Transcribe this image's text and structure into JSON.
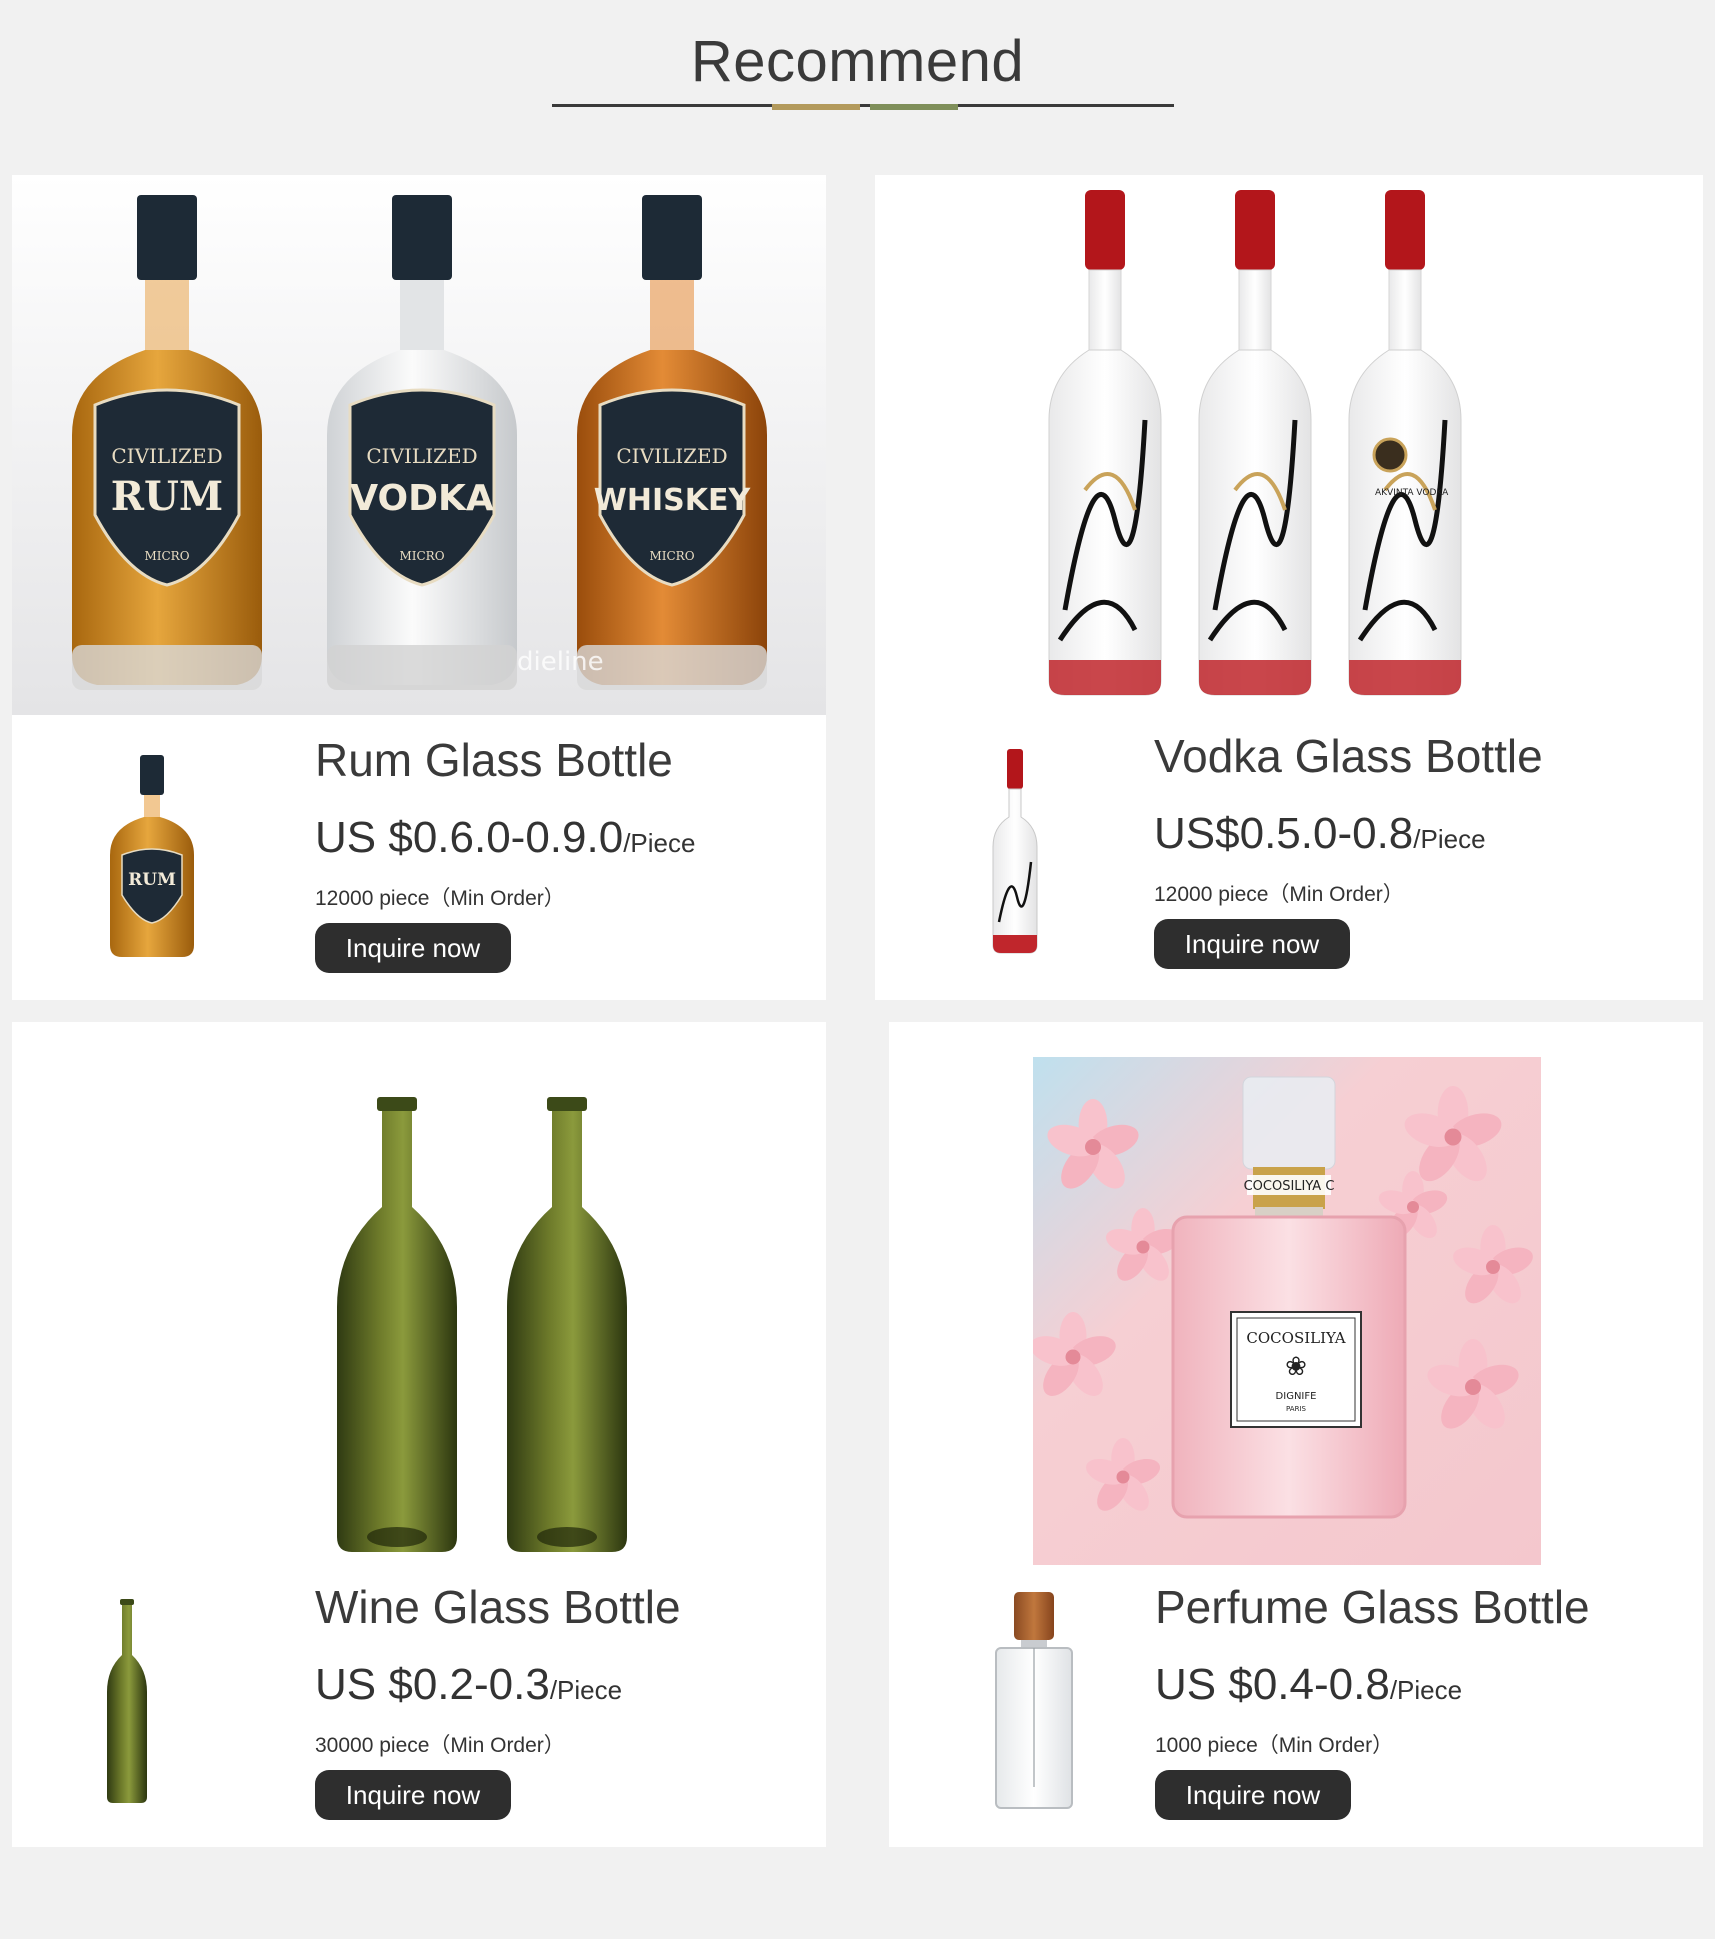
{
  "section": {
    "title": "Recommend",
    "accent_colors": [
      "#b39a5c",
      "#7f8f5a"
    ]
  },
  "products": [
    {
      "name": "Rum Glass Bottle",
      "price": "US $0.6.0-0.9.0",
      "unit": "/Piece",
      "moq": "12000 piece（Min Order）",
      "cta": "Inquire now",
      "hero_labels": [
        "RUM",
        "VODKA",
        "WHISKEY"
      ],
      "label_top": "CIVILIZED",
      "label_maker": "MICRO",
      "watermark": "dieline",
      "thumb_label": "RUM"
    },
    {
      "name": "Vodka Glass Bottle",
      "price": "US$0.5.0-0.8",
      "unit": "/Piece",
      "moq": "12000 piece（Min Order）",
      "cta": "Inquire now",
      "hero_label": "AKVINTA VODKA"
    },
    {
      "name": "Wine Glass Bottle",
      "price": "US $0.2-0.3",
      "unit": "/Piece",
      "moq": "30000 piece（Min Order）",
      "cta": "Inquire now"
    },
    {
      "name": "Perfume Glass Bottle",
      "price": "US $0.4-0.8",
      "unit": "/Piece",
      "moq": "1000 piece（Min Order）",
      "cta": "Inquire now",
      "collar_text": "COCOSILIYA C",
      "brand": "COCOSILIYA",
      "sub_brand": "DIGNIFE",
      "city": "PARIS"
    }
  ]
}
